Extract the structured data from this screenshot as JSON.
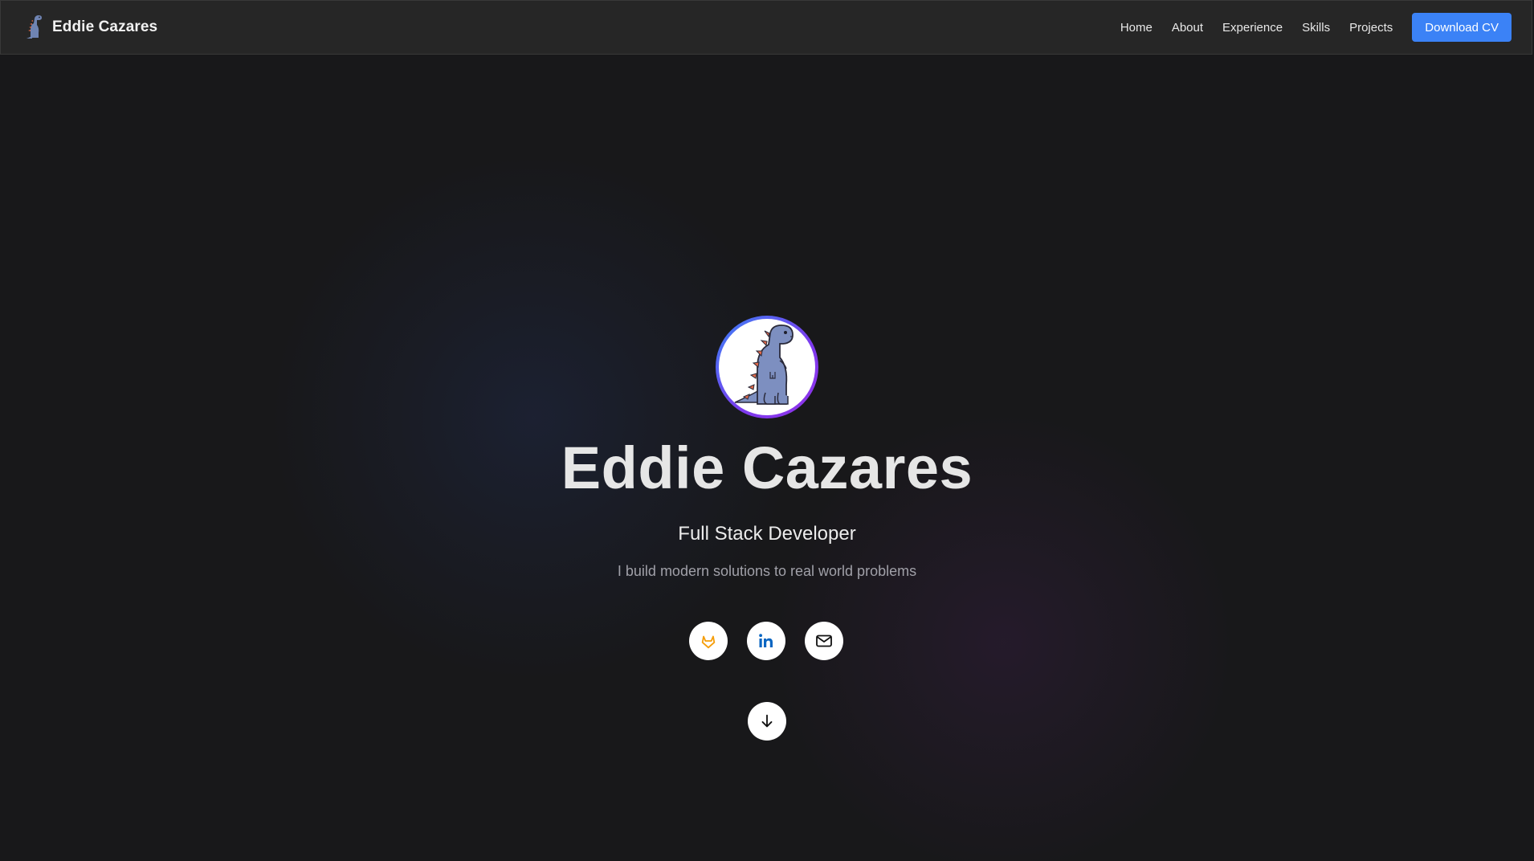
{
  "header": {
    "brand_name": "Eddie Cazares",
    "nav_items": [
      "Home",
      "About",
      "Experience",
      "Skills",
      "Projects"
    ],
    "cta_label": "Download CV"
  },
  "hero": {
    "name": "Eddie Cazares",
    "role": "Full Stack Developer",
    "tagline": "I build modern solutions to real world problems"
  },
  "social_links": [
    {
      "name": "gitlab",
      "icon": "gitlab-icon"
    },
    {
      "name": "linkedin",
      "icon": "linkedin-icon"
    },
    {
      "name": "email",
      "icon": "mail-icon"
    }
  ],
  "scroll_icon": "arrow-down-icon",
  "colors": {
    "background": "#18181a",
    "navbar": "#262626",
    "accent": "#3b82f6",
    "avatar_ring": "#7c3aed",
    "gitlab": "#f59e0b",
    "linkedin": "#0a66c2"
  }
}
